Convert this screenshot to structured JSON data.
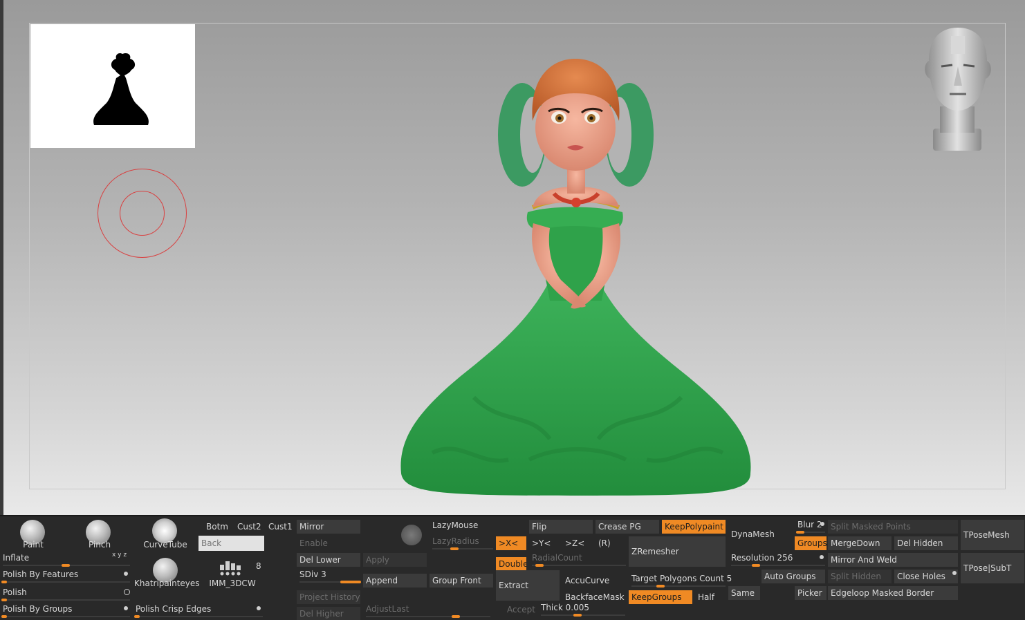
{
  "brushes": {
    "paint": "Paint",
    "pinch": "Pinch",
    "curvetube": "CurveTube",
    "khatripainteyes": "Khatripainteyes",
    "imm": "IMM_3DCW",
    "imm_count": "8"
  },
  "deformation": {
    "inflate": "Inflate",
    "inflate_axes": "x y z",
    "polish_by_features": "Polish By Features",
    "polish": "Polish",
    "polish_by_groups": "Polish By Groups",
    "polish_crisp_edges": "Polish Crisp Edges"
  },
  "views": {
    "botm": "Botm",
    "cust2": "Cust2",
    "cust1": "Cust1",
    "back_placeholder": "Back"
  },
  "subtool": {
    "mirror": "Mirror",
    "enable": "Enable",
    "apply": "Apply",
    "del_lower": "Del Lower",
    "sdiv": "SDiv 3",
    "append": "Append",
    "group_front": "Group Front",
    "project_history": "Project History",
    "del_higher": "Del Higher",
    "adjust_last": "AdjustLast"
  },
  "stroke": {
    "lazymouse": "LazyMouse",
    "lazyradius": "LazyRadius"
  },
  "symmetry": {
    "x": ">X<",
    "y": ">Y<",
    "z": ">Z<",
    "r": "(R)",
    "flip": "Flip",
    "radial_count": "RadialCount",
    "double": "Double",
    "extract": "Extract",
    "accept": "Accept",
    "thick": "Thick 0.005"
  },
  "zremesher": {
    "crease_pg": "Crease PG",
    "keep_polypaint": "KeepPolypaint",
    "zremesher": "ZRemesher",
    "accucurve": "AccuCurve",
    "target_polygons": "Target Polygons Count 5",
    "backface_mask": "BackfaceMask",
    "keep_groups": "KeepGroups",
    "half": "Half",
    "same": "Same"
  },
  "dynamesh": {
    "dynamesh": "DynaMesh",
    "blur": "Blur 2",
    "groups": "Groups",
    "resolution": "Resolution 256",
    "auto_groups": "Auto Groups",
    "picker": "Picker"
  },
  "mesh_ops": {
    "split_masked_points": "Split Masked Points",
    "merge_down": "MergeDown",
    "del_hidden": "Del Hidden",
    "mirror_and_weld": "Mirror And Weld",
    "split_hidden": "Split Hidden",
    "close_holes": "Close Holes",
    "edgeloop_masked_border": "Edgeloop Masked Border",
    "tpose_mesh": "TPoseMesh",
    "tpose_subt": "TPose|SubT"
  },
  "colors": {
    "accent": "#f08a24",
    "brush_cursor": "#d94040",
    "dress": "#2fa24a",
    "skin": "#e89a80",
    "hair": "#d47038"
  }
}
